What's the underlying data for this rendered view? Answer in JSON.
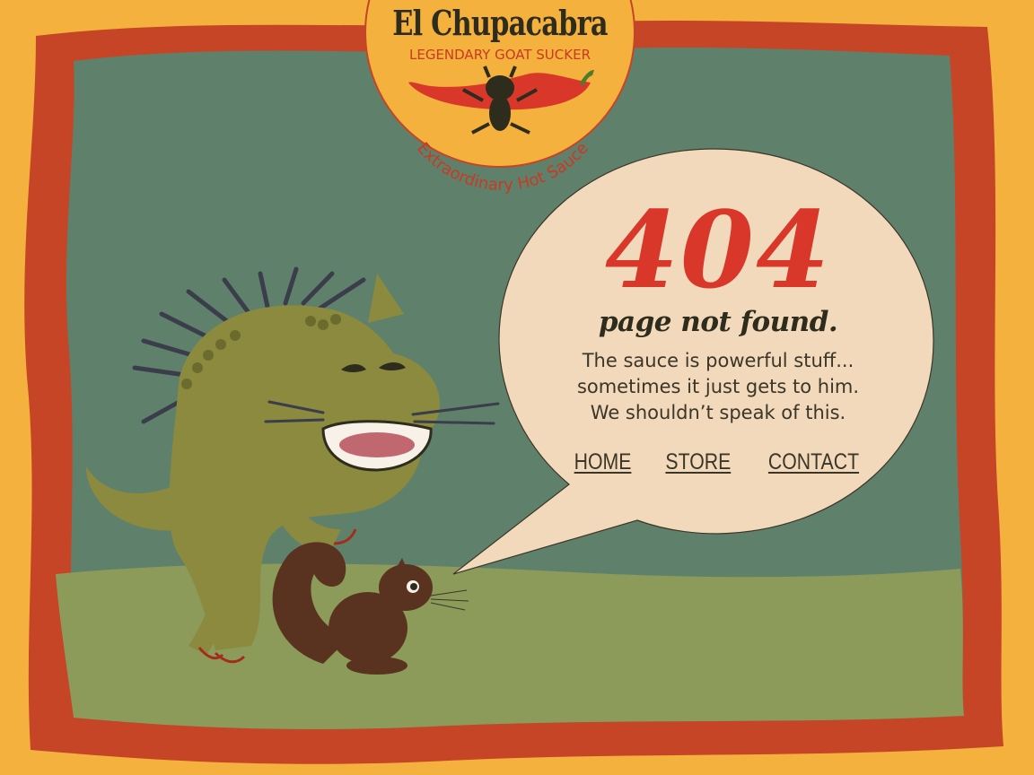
{
  "logo": {
    "title": "El Chupacabra",
    "tagline": "LEGENDARY GOAT SUCKER",
    "arc_text": "Extraordinary Hot Sauce"
  },
  "error": {
    "code": "404",
    "title": "page not found.",
    "message_lines": [
      "The sauce is powerful stuff...",
      "sometimes it just gets to him.",
      "We shouldn’t speak of this."
    ]
  },
  "nav": {
    "home": "HOME",
    "store": "STORE",
    "contact": "CONTACT"
  },
  "colors": {
    "background": "#f4b13e",
    "frame": "#c54526",
    "sky": "#5f816c",
    "ground": "#8c9a5a",
    "bubble": "#f2d9bc",
    "accent_red": "#d8372a",
    "dark_text": "#2e2c1c"
  },
  "icons": [
    "chupacabra-creature-illustration",
    "squirrel-illustration",
    "chili-pepper-icon"
  ]
}
